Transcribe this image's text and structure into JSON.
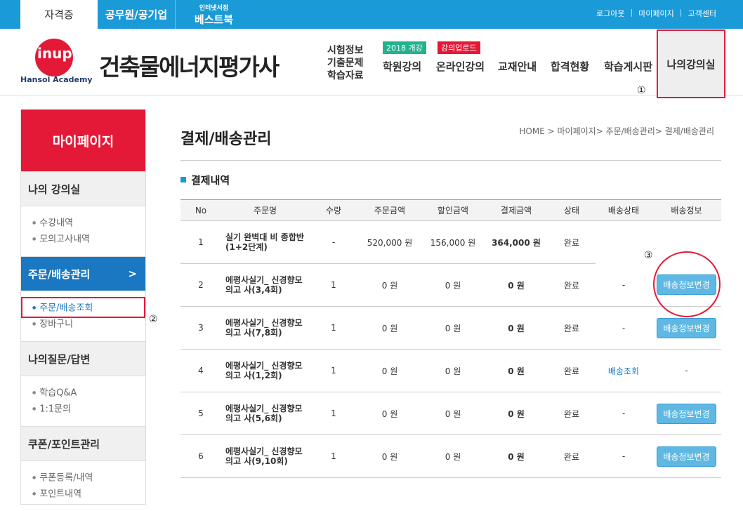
{
  "topbar": {
    "tabs": [
      "자격증",
      "공무원/공기업"
    ],
    "bestbook_small": "인터넷서점",
    "bestbook_big": "베스트북",
    "links": [
      "로그아웃",
      "마이페이지",
      "고객센터"
    ]
  },
  "header": {
    "logo": "inup",
    "logo_sub": "Hansol Academy",
    "title": "건축물에너지평가사",
    "exam_links": [
      "시험정보",
      "기출문제",
      "학습자료"
    ],
    "nav": [
      "학원강의",
      "온라인강의",
      "교재안내",
      "합격현황",
      "학습게시판",
      "나의강의실"
    ],
    "badge_academy": "2018 개강",
    "badge_online": "강의업로드",
    "marker1": "①"
  },
  "sidebar": {
    "head": "마이페이지",
    "sections": [
      {
        "label": "나의 강의실",
        "items": [
          "수강내역",
          "모의고사내역"
        ]
      },
      {
        "label": "주문/배송관리",
        "arrow": ">",
        "items": [
          "주문/배송조회",
          "장바구니"
        ]
      },
      {
        "label": "나의질문/답변",
        "items": [
          "학습Q&A",
          "1:1문의"
        ]
      },
      {
        "label": "쿠폰/포인트관리",
        "items": [
          "쿠폰등록/내역",
          "포인트내역"
        ]
      }
    ],
    "marker2": "②"
  },
  "main": {
    "title": "결제/배송관리",
    "breadcrumb": "HOME > 마이페이지> 주문/배송관리> 결제/배송관리",
    "section": "결제내역",
    "marker3": "③",
    "columns": [
      "No",
      "주문명",
      "수량",
      "주문금액",
      "할인금액",
      "결제금액",
      "상태",
      "배송상태",
      "배송정보"
    ],
    "rows": [
      {
        "no": "1",
        "name": "실기 완벽대 비 종합반 (1+2단계)",
        "qty": "-",
        "order": "520,000 원",
        "discount": "156,000 원",
        "pay": "364,000 원",
        "status": "완료",
        "ship": "",
        "info": ""
      },
      {
        "no": "2",
        "name": "에평사실기_ 신경향모의고 사(3,4회)",
        "qty": "1",
        "order": "0 원",
        "discount": "0 원",
        "pay": "0 원",
        "status": "완료",
        "ship": "-",
        "info": "배송정보변경"
      },
      {
        "no": "3",
        "name": "에평사실기_ 신경향모의고 사(7,8회)",
        "qty": "1",
        "order": "0 원",
        "discount": "0 원",
        "pay": "0 원",
        "status": "완료",
        "ship": "-",
        "info": "배송정보변경"
      },
      {
        "no": "4",
        "name": "에평사실기_ 신경향모의고 사(1,2회)",
        "qty": "1",
        "order": "0 원",
        "discount": "0 원",
        "pay": "0 원",
        "status": "완료",
        "ship": "배송조회",
        "info": "-"
      },
      {
        "no": "5",
        "name": "에평사실기_ 신경향모의고 사(5,6회)",
        "qty": "1",
        "order": "0 원",
        "discount": "0 원",
        "pay": "0 원",
        "status": "완료",
        "ship": "-",
        "info": "배송정보변경"
      },
      {
        "no": "6",
        "name": "에평사실기_ 신경향모의고 사(9,10회)",
        "qty": "1",
        "order": "0 원",
        "discount": "0 원",
        "pay": "0 원",
        "status": "완료",
        "ship": "-",
        "info": "배송정보변경"
      }
    ]
  },
  "colors": {
    "accent": "#1a9ad6",
    "brand_red": "#e31937",
    "active_blue": "#1a78c2",
    "button": "#5eb8e3"
  }
}
